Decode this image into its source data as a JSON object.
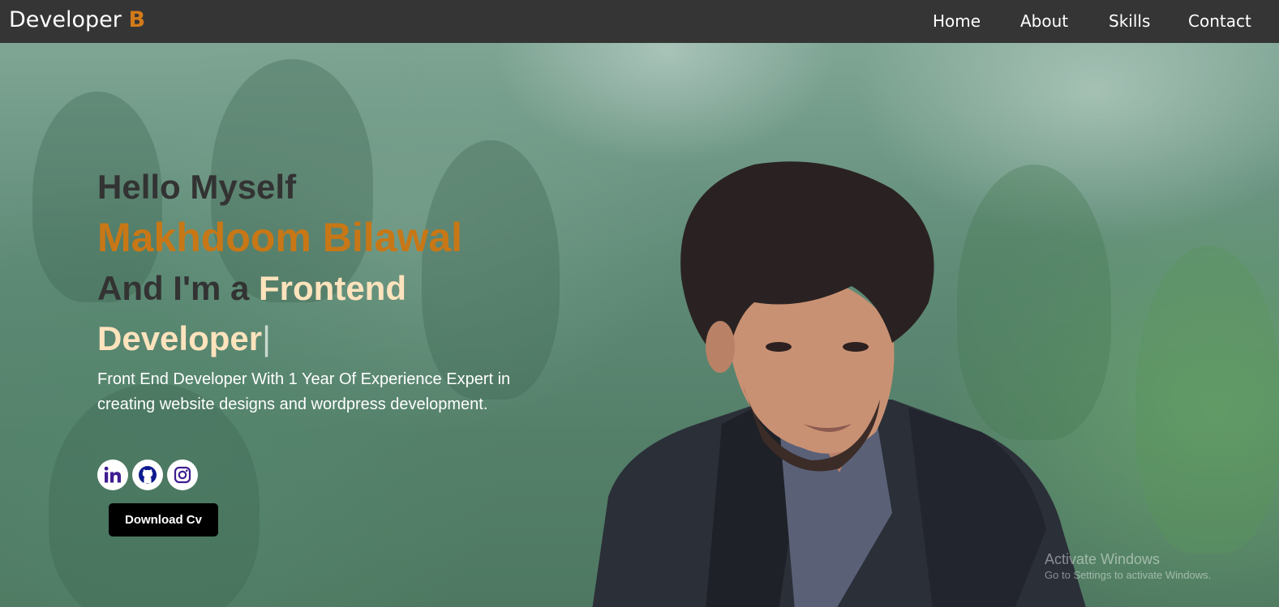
{
  "navbar": {
    "brand_text": "Developer",
    "brand_accent": "B",
    "links": [
      "Home",
      "About",
      "Skills",
      "Contact"
    ]
  },
  "hero": {
    "greeting": "Hello Myself",
    "name": "Makhdoom Bilawal",
    "role_prefix": "And I'm a",
    "role_typed": "Frontend Developer",
    "cursor": "|",
    "description": "Front End Developer With 1 Year Of Experience Expert in creating website designs and wordpress development.",
    "download_label": "Download Cv"
  },
  "socials": [
    {
      "icon": "linkedin-icon"
    },
    {
      "icon": "github-icon"
    },
    {
      "icon": "instagram-icon"
    }
  ],
  "watermark": {
    "title": "Activate Windows",
    "subtitle": "Go to Settings to activate Windows."
  },
  "colors": {
    "navbar_bg": "#353535",
    "accent": "#c87716",
    "typed": "#ffe3bd",
    "button_bg": "#000000",
    "social_icon": "#3f1d91"
  }
}
